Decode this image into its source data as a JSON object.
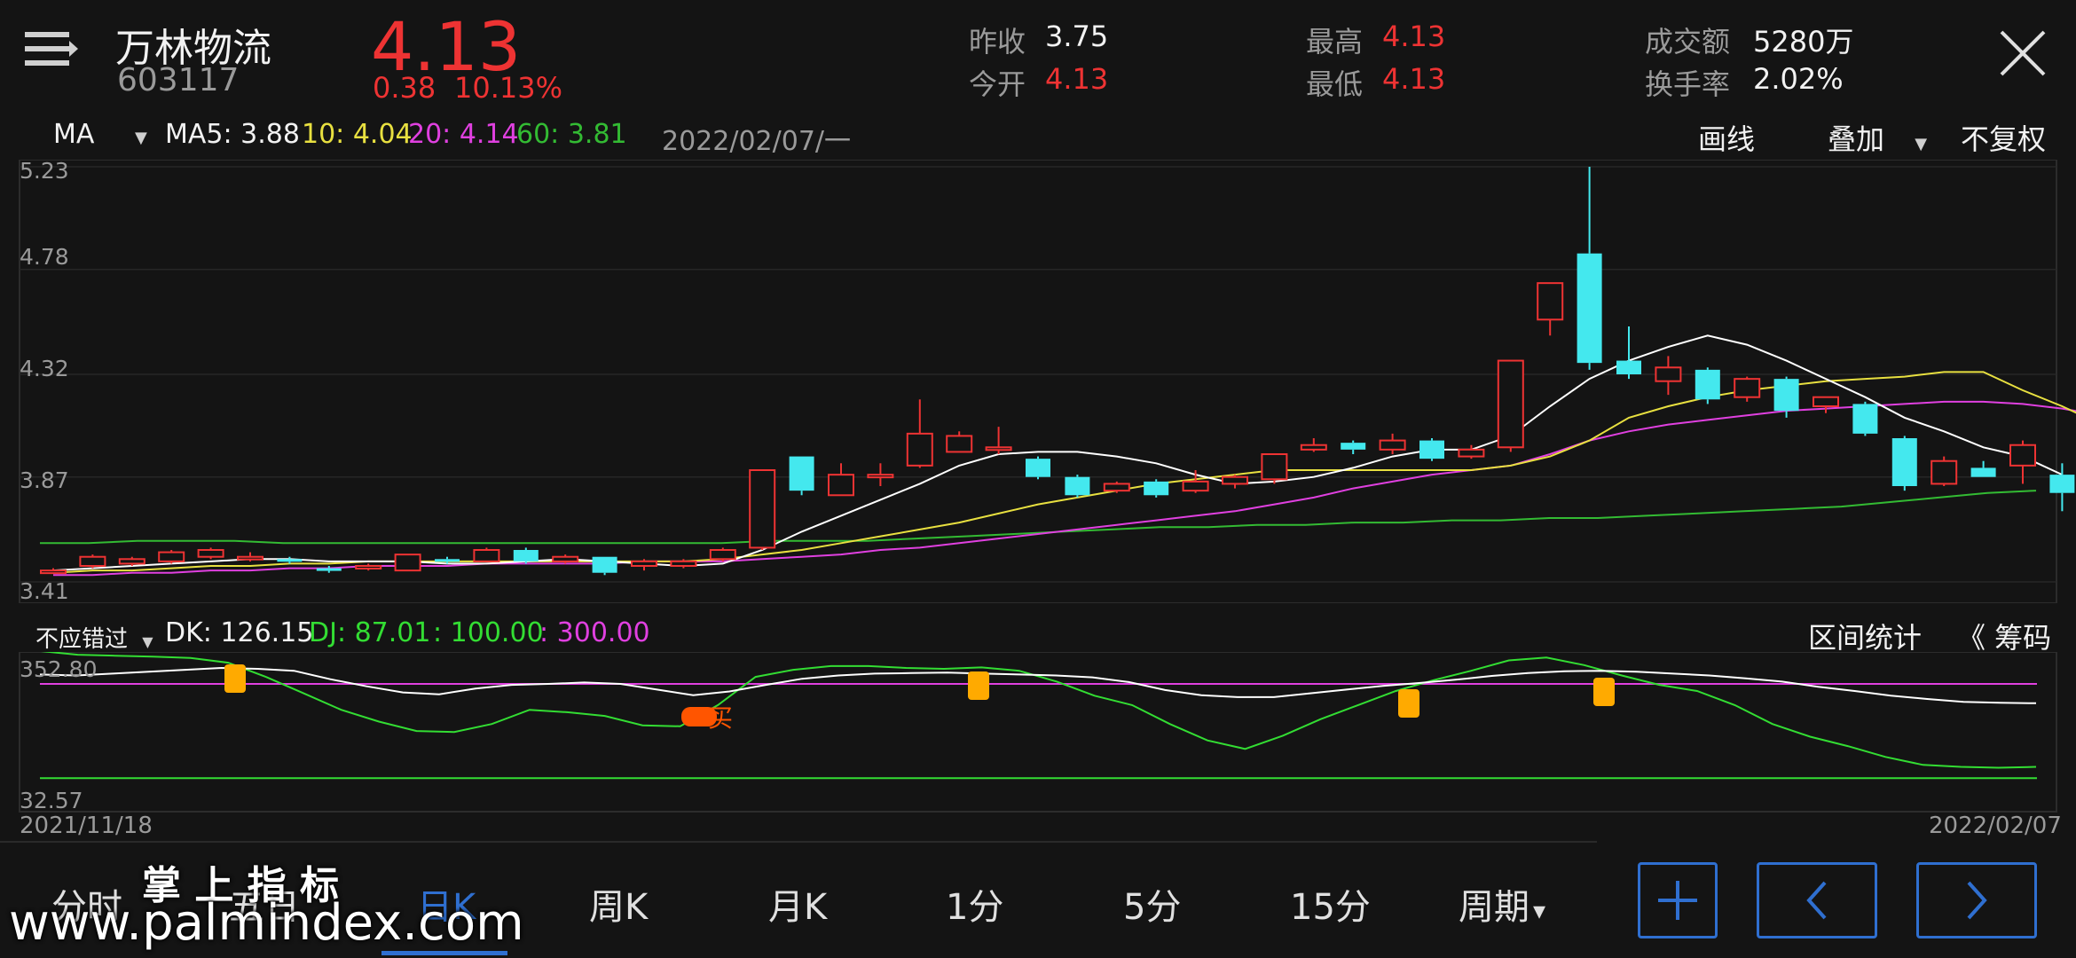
{
  "header": {
    "name": "万林物流",
    "code": "603117",
    "price": "4.13",
    "change": "0.38",
    "change_pct": "10.13%",
    "prev_close_label": "昨收",
    "prev_close": "3.75",
    "open_label": "今开",
    "open": "4.13",
    "high_label": "最高",
    "high": "4.13",
    "low_label": "最低",
    "low": "4.13",
    "turnover_label": "成交额",
    "turnover": "5280万",
    "turnover_rate_label": "换手率",
    "turnover_rate": "2.02%"
  },
  "ma_bar": {
    "indicator": "MA",
    "ma5": "MA5: 3.88",
    "ma10": "10: 4.04",
    "ma20": "20: 4.14",
    "ma60": "60: 3.81",
    "date": "2022/02/07/一",
    "draw": "画线",
    "overlay": "叠加",
    "adjust": "不复权"
  },
  "colors": {
    "up": "#ee3333",
    "down": "#44e8ee",
    "ma5": "#ffffff",
    "ma10": "#e8e040",
    "ma20": "#e040e0",
    "ma60": "#33bb33",
    "accent": "#2f6fd0"
  },
  "price_axis": [
    "5.23",
    "4.78",
    "4.32",
    "3.87",
    "3.41"
  ],
  "sub_bar": {
    "indicator": "不应错过",
    "dk": "DK: 126.15",
    "dj": "DJ: 87.01",
    "l100": ": 100.00",
    "l300": ": 300.00",
    "range_stats": "区间统计",
    "chips": "《 筹码"
  },
  "sub_axis": [
    "352.80",
    "32.57"
  ],
  "buy_label": "买",
  "dates": {
    "start": "2021/11/18",
    "end": "2022/02/07"
  },
  "tabs": [
    "分时",
    "五日",
    "日K",
    "周K",
    "月K",
    "1分",
    "5分",
    "15分",
    "周期"
  ],
  "active_tab": "日K",
  "watermark": {
    "title": "掌 上 指 标",
    "url": "www.palmindex.com"
  },
  "chart_data": {
    "type": "candlestick",
    "candles": [
      {
        "o": 3.46,
        "c": 3.46,
        "h": 3.47,
        "l": 3.45
      },
      {
        "o": 3.48,
        "c": 3.52,
        "h": 3.53,
        "l": 3.47
      },
      {
        "o": 3.49,
        "c": 3.51,
        "h": 3.52,
        "l": 3.48
      },
      {
        "o": 3.5,
        "c": 3.54,
        "h": 3.55,
        "l": 3.49
      },
      {
        "o": 3.52,
        "c": 3.55,
        "h": 3.56,
        "l": 3.51
      },
      {
        "o": 3.52,
        "c": 3.52,
        "h": 3.54,
        "l": 3.5
      },
      {
        "o": 3.51,
        "c": 3.5,
        "h": 3.52,
        "l": 3.49
      },
      {
        "o": 3.47,
        "c": 3.46,
        "h": 3.48,
        "l": 3.45
      },
      {
        "o": 3.47,
        "c": 3.48,
        "h": 3.49,
        "l": 3.46
      },
      {
        "o": 3.46,
        "c": 3.53,
        "h": 3.53,
        "l": 3.46
      },
      {
        "o": 3.51,
        "c": 3.5,
        "h": 3.52,
        "l": 3.49
      },
      {
        "o": 3.5,
        "c": 3.55,
        "h": 3.56,
        "l": 3.5
      },
      {
        "o": 3.55,
        "c": 3.5,
        "h": 3.56,
        "l": 3.49
      },
      {
        "o": 3.5,
        "c": 3.52,
        "h": 3.53,
        "l": 3.49
      },
      {
        "o": 3.52,
        "c": 3.45,
        "h": 3.52,
        "l": 3.44
      },
      {
        "o": 3.48,
        "c": 3.5,
        "h": 3.51,
        "l": 3.46
      },
      {
        "o": 3.48,
        "c": 3.5,
        "h": 3.51,
        "l": 3.47
      },
      {
        "o": 3.51,
        "c": 3.55,
        "h": 3.56,
        "l": 3.5
      },
      {
        "o": 3.56,
        "c": 3.9,
        "h": 3.9,
        "l": 3.55
      },
      {
        "o": 3.96,
        "c": 3.81,
        "h": 3.96,
        "l": 3.79
      },
      {
        "o": 3.79,
        "c": 3.88,
        "h": 3.93,
        "l": 3.79
      },
      {
        "o": 3.88,
        "c": 3.88,
        "h": 3.93,
        "l": 3.83
      },
      {
        "o": 3.92,
        "c": 4.06,
        "h": 4.21,
        "l": 3.91
      },
      {
        "o": 3.98,
        "c": 4.05,
        "h": 4.07,
        "l": 3.98
      },
      {
        "o": 4.0,
        "c": 4.0,
        "h": 4.09,
        "l": 3.97
      },
      {
        "o": 3.95,
        "c": 3.87,
        "h": 3.96,
        "l": 3.86
      },
      {
        "o": 3.87,
        "c": 3.79,
        "h": 3.88,
        "l": 3.78
      },
      {
        "o": 3.81,
        "c": 3.84,
        "h": 3.85,
        "l": 3.8
      },
      {
        "o": 3.85,
        "c": 3.79,
        "h": 3.86,
        "l": 3.78
      },
      {
        "o": 3.81,
        "c": 3.85,
        "h": 3.9,
        "l": 3.8
      },
      {
        "o": 3.84,
        "c": 3.87,
        "h": 3.88,
        "l": 3.82
      },
      {
        "o": 3.86,
        "c": 3.97,
        "h": 3.97,
        "l": 3.84
      },
      {
        "o": 3.99,
        "c": 4.01,
        "h": 4.04,
        "l": 3.98
      },
      {
        "o": 4.02,
        "c": 3.99,
        "h": 4.03,
        "l": 3.97
      },
      {
        "o": 3.99,
        "c": 4.03,
        "h": 4.06,
        "l": 3.97
      },
      {
        "o": 4.03,
        "c": 3.95,
        "h": 4.04,
        "l": 3.94
      },
      {
        "o": 3.96,
        "c": 3.99,
        "h": 4.01,
        "l": 3.95
      },
      {
        "o": 4.0,
        "c": 4.38,
        "h": 4.38,
        "l": 3.98
      },
      {
        "o": 4.56,
        "c": 4.72,
        "h": 4.72,
        "l": 4.49
      },
      {
        "o": 4.85,
        "c": 4.37,
        "h": 5.23,
        "l": 4.34
      },
      {
        "o": 4.38,
        "c": 4.32,
        "h": 4.53,
        "l": 4.3
      },
      {
        "o": 4.29,
        "c": 4.35,
        "h": 4.4,
        "l": 4.23
      },
      {
        "o": 4.34,
        "c": 4.21,
        "h": 4.35,
        "l": 4.19
      },
      {
        "o": 4.22,
        "c": 4.3,
        "h": 4.31,
        "l": 4.2
      },
      {
        "o": 4.3,
        "c": 4.16,
        "h": 4.31,
        "l": 4.13
      },
      {
        "o": 4.18,
        "c": 4.22,
        "h": 4.22,
        "l": 4.15
      },
      {
        "o": 4.19,
        "c": 4.06,
        "h": 4.2,
        "l": 4.05
      },
      {
        "o": 4.04,
        "c": 3.83,
        "h": 4.05,
        "l": 3.81
      },
      {
        "o": 3.84,
        "c": 3.94,
        "h": 3.96,
        "l": 3.83
      },
      {
        "o": 3.91,
        "c": 3.87,
        "h": 3.94,
        "l": 3.87
      },
      {
        "o": 3.92,
        "c": 4.01,
        "h": 4.03,
        "l": 3.84
      },
      {
        "o": 3.88,
        "c": 3.8,
        "h": 3.93,
        "l": 3.72
      }
    ],
    "ma5": [
      3.46,
      3.47,
      3.48,
      3.49,
      3.5,
      3.51,
      3.51,
      3.5,
      3.5,
      3.5,
      3.49,
      3.49,
      3.5,
      3.51,
      3.5,
      3.49,
      3.48,
      3.49,
      3.55,
      3.63,
      3.7,
      3.77,
      3.84,
      3.92,
      3.97,
      3.98,
      3.98,
      3.96,
      3.93,
      3.88,
      3.84,
      3.85,
      3.87,
      3.91,
      3.96,
      3.99,
      3.99,
      4.05,
      4.18,
      4.3,
      4.38,
      4.44,
      4.49,
      4.45,
      4.38,
      4.3,
      4.22,
      4.13,
      4.07,
      4.0,
      3.96,
      3.88
    ],
    "ma10": [
      3.45,
      3.46,
      3.46,
      3.47,
      3.48,
      3.48,
      3.49,
      3.49,
      3.5,
      3.5,
      3.5,
      3.5,
      3.5,
      3.5,
      3.5,
      3.5,
      3.5,
      3.51,
      3.53,
      3.55,
      3.58,
      3.61,
      3.64,
      3.67,
      3.71,
      3.75,
      3.78,
      3.81,
      3.84,
      3.86,
      3.88,
      3.9,
      3.9,
      3.9,
      3.9,
      3.9,
      3.9,
      3.92,
      3.96,
      4.03,
      4.13,
      4.18,
      4.22,
      4.25,
      4.27,
      4.29,
      4.3,
      4.31,
      4.33,
      4.33,
      4.25,
      4.18,
      4.1,
      4.04
    ],
    "ma20": [
      3.44,
      3.44,
      3.45,
      3.45,
      3.46,
      3.46,
      3.47,
      3.47,
      3.48,
      3.48,
      3.48,
      3.49,
      3.49,
      3.49,
      3.49,
      3.5,
      3.5,
      3.5,
      3.51,
      3.52,
      3.53,
      3.55,
      3.56,
      3.58,
      3.6,
      3.62,
      3.64,
      3.66,
      3.68,
      3.7,
      3.72,
      3.75,
      3.78,
      3.82,
      3.85,
      3.88,
      3.9,
      3.92,
      3.97,
      4.03,
      4.07,
      4.1,
      4.12,
      4.14,
      4.16,
      4.17,
      4.18,
      4.19,
      4.2,
      4.2,
      4.19,
      4.17,
      4.14
    ],
    "ma60": [
      3.58,
      3.58,
      3.59,
      3.59,
      3.59,
      3.58,
      3.58,
      3.58,
      3.58,
      3.58,
      3.58,
      3.58,
      3.58,
      3.58,
      3.58,
      3.59,
      3.59,
      3.59,
      3.6,
      3.61,
      3.62,
      3.63,
      3.64,
      3.65,
      3.65,
      3.66,
      3.66,
      3.67,
      3.67,
      3.68,
      3.68,
      3.69,
      3.69,
      3.7,
      3.71,
      3.72,
      3.73,
      3.74,
      3.76,
      3.78,
      3.8,
      3.81
    ],
    "y_range": [
      3.41,
      5.23
    ],
    "sub_chart": {
      "dk": [
        320,
        318,
        322,
        326,
        330,
        334,
        332,
        328,
        310,
        295,
        282,
        278,
        290,
        298,
        300,
        303,
        300,
        288,
        276,
        284,
        298,
        311,
        318,
        322,
        323,
        324,
        322,
        320,
        318,
        314,
        304,
        287,
        276,
        272,
        272,
        280,
        288,
        296,
        302,
        309,
        317,
        323,
        327,
        328,
        326,
        322,
        318,
        312,
        305,
        294,
        285,
        275,
        268,
        262,
        260,
        259
      ],
      "dj": [
        370,
        362,
        360,
        358,
        355,
        345,
        315,
        280,
        245,
        220,
        200,
        198,
        215,
        245,
        240,
        232,
        212,
        210,
        255,
        315,
        330,
        338,
        338,
        334,
        332,
        335,
        328,
        305,
        275,
        255,
        215,
        180,
        162,
        190,
        225,
        255,
        285,
        308,
        328,
        350,
        356,
        340,
        318,
        298,
        285,
        255,
        215,
        188,
        168,
        145,
        128,
        124,
        122,
        124
      ],
      "levels": [
        100,
        300
      ],
      "y_range": [
        32.57,
        352.8
      ]
    }
  }
}
